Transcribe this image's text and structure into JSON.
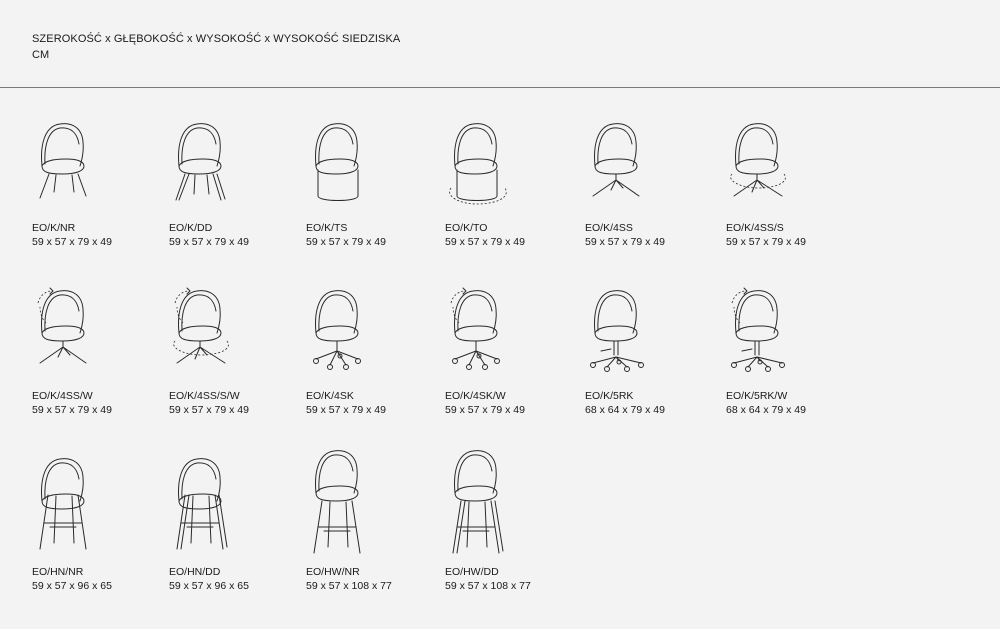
{
  "header": {
    "line1": "SZEROKOŚĆ x GŁĘBOKOŚĆ x WYSOKOŚĆ x WYSOKOŚĆ SIEDZISKA",
    "line2": "CM"
  },
  "products": [
    {
      "code": "EO/K/NR",
      "dims": "59 x 57 x 79 x 49",
      "base": "4legs-metal",
      "swivel": false
    },
    {
      "code": "EO/K/DD",
      "dims": "59 x 57 x 79 x 49",
      "base": "4legs-wood",
      "swivel": false
    },
    {
      "code": "EO/K/TS",
      "dims": "59 x 57 x 79 x 49",
      "base": "drum",
      "swivel": false
    },
    {
      "code": "EO/K/TO",
      "dims": "59 x 57 x 79 x 49",
      "base": "drum-rotating",
      "swivel": false
    },
    {
      "code": "EO/K/4SS",
      "dims": "59 x 57 x 79 x 49",
      "base": "4star",
      "swivel": false
    },
    {
      "code": "EO/K/4SS/S",
      "dims": "59 x 57 x 79 x 49",
      "base": "4star-rotating",
      "swivel": false
    },
    {
      "code": "EO/K/4SS/W",
      "dims": "59 x 57 x 79 x 49",
      "base": "4star",
      "swivel": true
    },
    {
      "code": "EO/K/4SS/S/W",
      "dims": "59 x 57 x 79 x 49",
      "base": "4star-rotating",
      "swivel": true
    },
    {
      "code": "EO/K/4SK",
      "dims": "59 x 57 x 79 x 49",
      "base": "5castor",
      "swivel": false
    },
    {
      "code": "EO/K/4SK/W",
      "dims": "59 x 57 x 79 x 49",
      "base": "5castor",
      "swivel": true
    },
    {
      "code": "EO/K/5RK",
      "dims": "68 x 64 x 79 x 49",
      "base": "office",
      "swivel": false
    },
    {
      "code": "EO/K/5RK/W",
      "dims": "68 x 64 x 79 x 49",
      "base": "office",
      "swivel": true
    },
    {
      "code": "EO/HN/NR",
      "dims": "59 x 57 x 96 x 65",
      "base": "stool-metal",
      "swivel": false
    },
    {
      "code": "EO/HN/DD",
      "dims": "59 x 57 x 96 x 65",
      "base": "stool-wood",
      "swivel": false
    },
    {
      "code": "EO/HW/NR",
      "dims": "59 x 57 x 108 x 77",
      "base": "bar-metal",
      "swivel": false
    },
    {
      "code": "EO/HW/DD",
      "dims": "59 x 57 x 108 x 77",
      "base": "bar-wood",
      "swivel": false
    }
  ]
}
